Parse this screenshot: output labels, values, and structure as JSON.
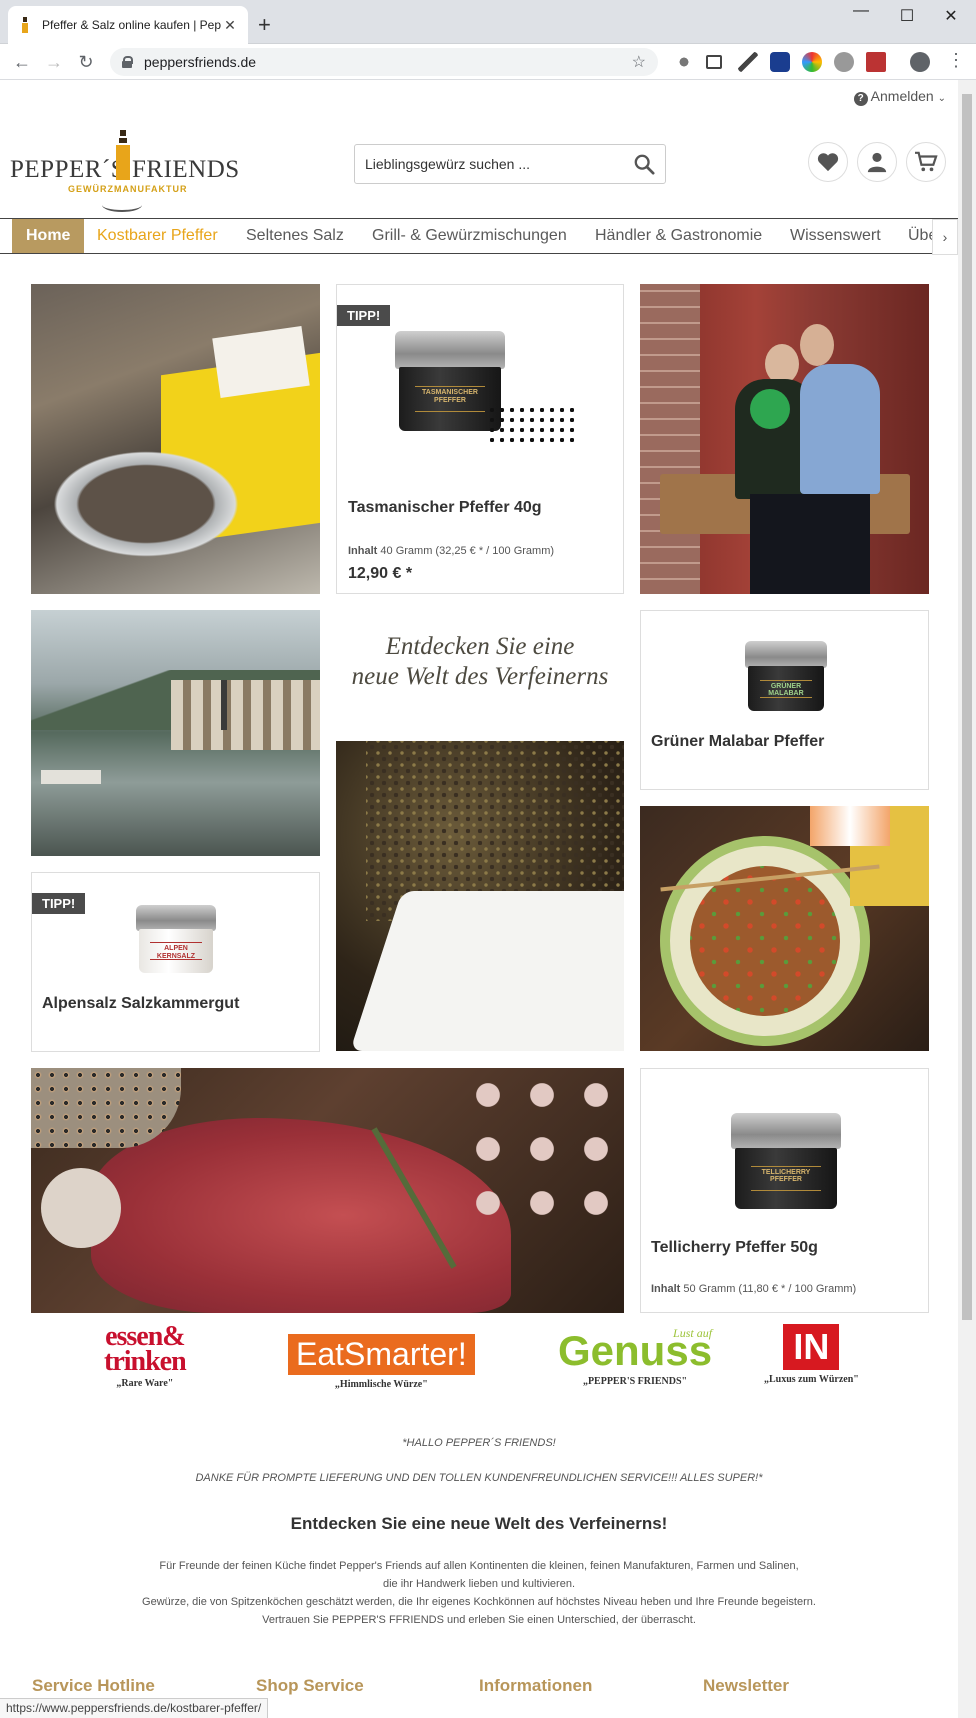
{
  "browser": {
    "tab_title": "Pfeffer & Salz online kaufen | Pep",
    "url": "peppersfriends.de",
    "status_url": "https://www.peppersfriends.de/kostbarer-pfeffer/"
  },
  "header": {
    "login_label": "Anmelden",
    "logo": {
      "left": "PEPPER´S",
      "right": "FRIENDS",
      "sub": "GEWÜRZMANUFAKTUR"
    },
    "search_placeholder": "Lieblingsgewürz suchen ..."
  },
  "nav": {
    "items": [
      "Home",
      "Kostbarer Pfeffer",
      "Seltenes Salz",
      "Grill- & Gewürzmischungen",
      "Händler & Gastronomie",
      "Wissenswert",
      "Übe"
    ]
  },
  "products": [
    {
      "badge": "TIPP!",
      "name": "Tasmanischer Pfeffer 40g",
      "info_label": "Inhalt",
      "info_value": "40 Gramm (32,25 € * / 100 Gramm)",
      "price": "12,90 € *",
      "jar_label": "TASMANISCHER PFEFFER"
    },
    {
      "name": "Grüner Malabar Pfeffer",
      "jar_label": "GRÜNER MALABAR"
    },
    {
      "badge": "TIPP!",
      "name": "Alpensalz Salzkammergut",
      "jar_label": "ALPEN KERNSALZ"
    },
    {
      "name": "Tellicherry Pfeffer 50g",
      "info_label": "Inhalt",
      "info_value": "50 Gramm (11,80 € * / 100 Gramm)",
      "jar_label": "TELLICHERRY PFEFFER"
    }
  ],
  "slogan": {
    "line1": "Entdecken Sie eine",
    "line2": "neue Welt des Verfeinerns"
  },
  "press": [
    {
      "name1": "essen&",
      "name2": "trinken",
      "caption": "„Rare Ware\""
    },
    {
      "name1": "EatSmarter!",
      "caption": "„Himmlische Würze\""
    },
    {
      "name1": "Genuss",
      "name_script": "Lust auf",
      "caption": "„PEPPER'S FRIENDS\""
    },
    {
      "name1": "IN",
      "caption": "„Luxus zum Würzen\""
    }
  ],
  "testimonial": {
    "line1": "*HALLO PEPPER´S FRIENDS!",
    "line2": "DANKE FÜR PROMPTE LIEFERUNG UND DEN TOLLEN KUNDENFREUNDLICHEN SERVICE!!! ALLES SUPER!*"
  },
  "intro": {
    "heading": "Entdecken Sie eine neue Welt des Verfeinerns!",
    "lines": [
      "Für Freunde der feinen Küche findet Pepper's Friends auf allen Kontinenten die kleinen, feinen Manufakturen, Farmen und Salinen,",
      "die ihr Handwerk lieben und kultivieren.",
      "Gewürze, die von Spitzenköchen geschätzt werden, die Ihr eigenes Kochkönnen auf höchstes Niveau heben und Ihre Freunde begeistern.",
      "Vertrauen Sie PEPPER'S FFRIENDS und erleben Sie einen Unterschied, der überrascht."
    ]
  },
  "footer": {
    "headings": [
      "Service Hotline",
      "Shop Service",
      "Informationen",
      "Newsletter"
    ]
  },
  "colors": {
    "gold": "#e8a51a",
    "nav_active": "#b89a60",
    "footer_heading": "#b8965a"
  }
}
